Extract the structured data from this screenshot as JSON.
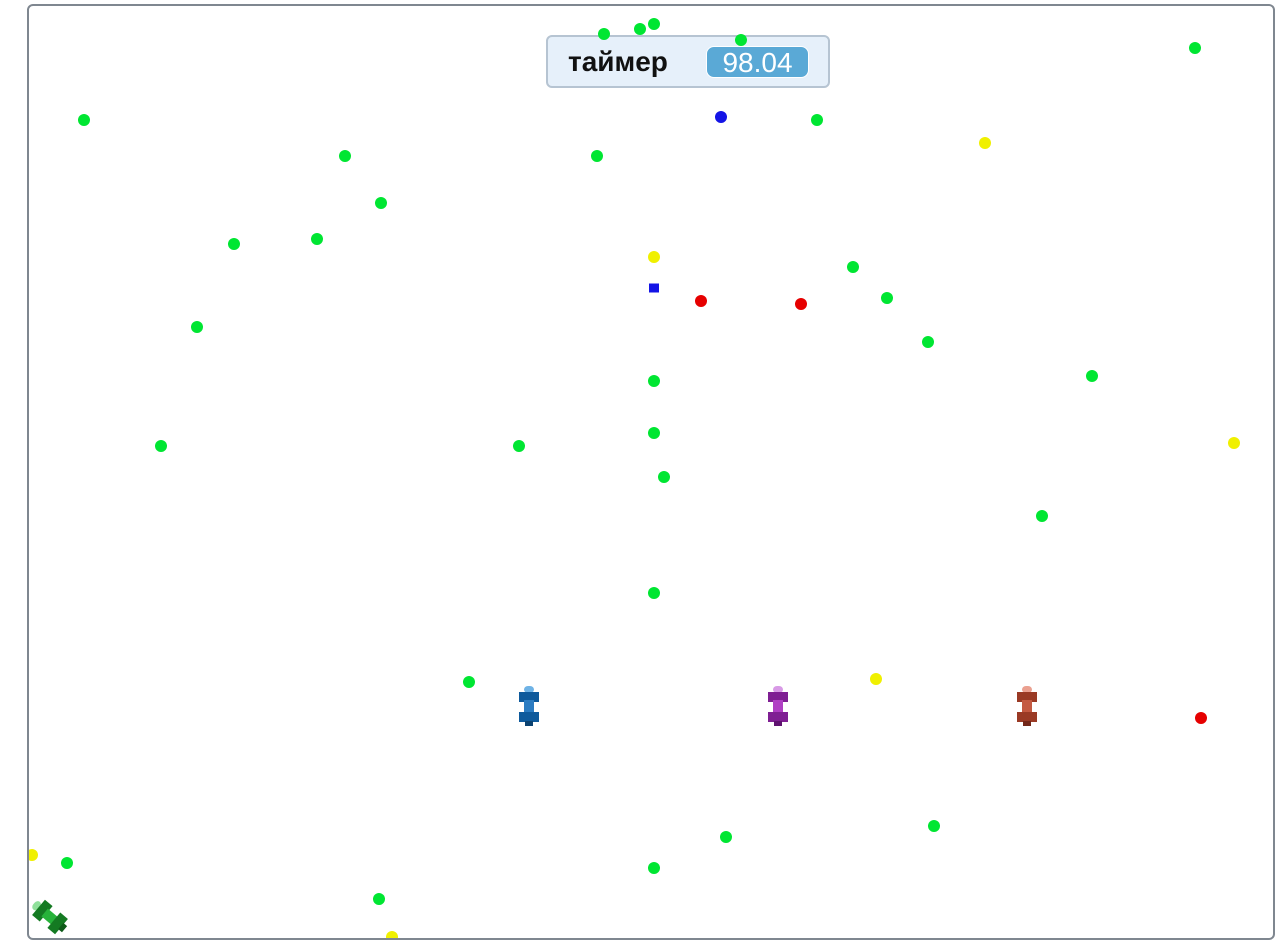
{
  "timer": {
    "label": "таймер",
    "value": "98.04"
  },
  "colors": {
    "green": "#00e632",
    "yellow": "#f0f000",
    "red": "#e60000",
    "blue": "#1414e6",
    "car_blue": "#0e5a9c",
    "car_purple": "#9b2fae",
    "car_red": "#b54a33",
    "car_green": "#1c9e2c"
  },
  "sprites": {
    "dots": "food-dot",
    "cars": [
      "blue-car",
      "purple-car",
      "red-car",
      "green-car"
    ],
    "blue-square": "blue-square"
  }
}
